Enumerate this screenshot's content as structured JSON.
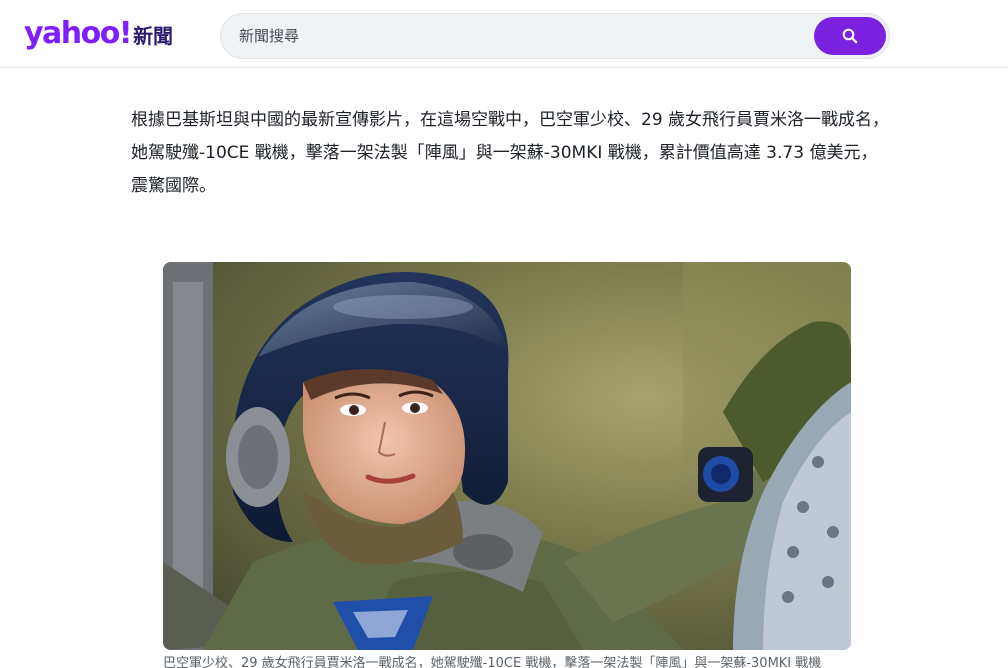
{
  "header": {
    "logo_text": "yahoo!",
    "section_label": "新聞",
    "search_placeholder": "新聞搜尋"
  },
  "article": {
    "paragraph": "根據巴基斯坦與中國的最新宣傳影片，在這場空戰中，巴空軍少校、29 歲女飛行員賈米洛一戰成名，她駕駛殲-10CE 戰機，擊落一架法製「陣風」與一架蘇-30MKI 戰機，累計價值高達 3.73 億美元，震驚國際。",
    "caption": "巴空軍少校、29 歲女飛行員賈米洛一戰成名，她駕駛殲-10CE 戰機，擊落一架法製「陣風」與一架蘇-30MKI 戰機"
  },
  "colors": {
    "brand_purple": "#7e1fff",
    "search_button": "#7b22e0",
    "text": "#1d2228"
  },
  "icons": {
    "search": "magnifier-icon"
  }
}
